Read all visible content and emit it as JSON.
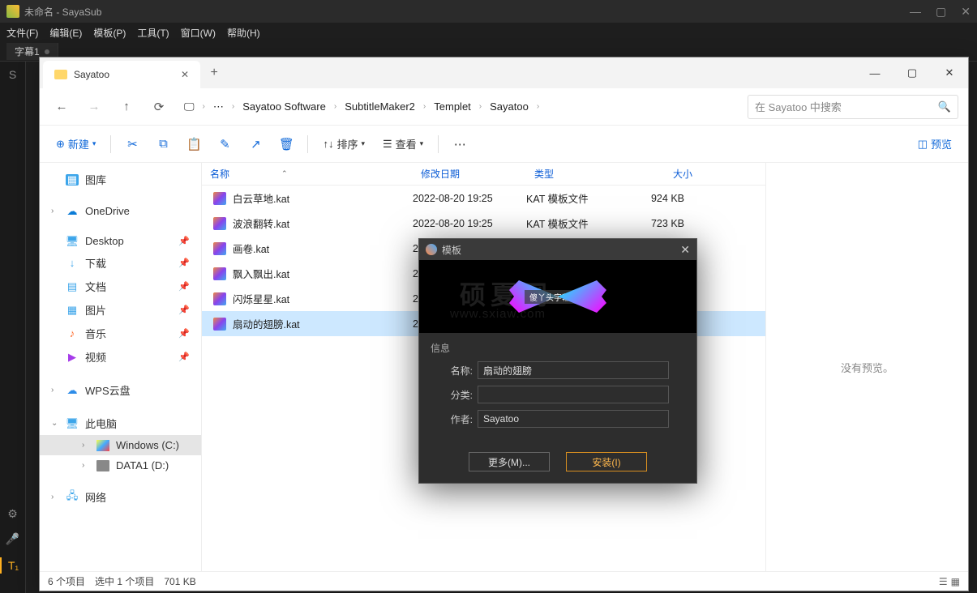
{
  "sayasub": {
    "title": "未命名 - SayaSub",
    "menus": [
      "文件(F)",
      "编辑(E)",
      "模板(P)",
      "工具(T)",
      "窗口(W)",
      "帮助(H)"
    ],
    "tab": "字幕1",
    "leftbar_items": [
      "S",
      "⚙",
      "🎤",
      "T₁"
    ]
  },
  "explorer": {
    "tab_title": "Sayatoo",
    "breadcrumb": [
      "Sayatoo Software",
      "SubtitleMaker2",
      "Templet",
      "Sayatoo"
    ],
    "search_placeholder": "在 Sayatoo 中搜索",
    "toolbar": {
      "new_label": "新建",
      "sort_label": "排序",
      "view_label": "查看",
      "preview_label": "预览"
    },
    "columns": {
      "name": "名称",
      "date": "修改日期",
      "type": "类型",
      "size": "大小"
    },
    "sidebar": [
      {
        "label": "图库",
        "icon": "gallery",
        "chev": ""
      },
      {
        "label": "OneDrive",
        "icon": "onedrive",
        "chev": "›"
      },
      {
        "label": "Desktop",
        "icon": "desktop",
        "chev": "",
        "pin": true
      },
      {
        "label": "下载",
        "icon": "download",
        "chev": "",
        "pin": true
      },
      {
        "label": "文档",
        "icon": "doc",
        "chev": "",
        "pin": true
      },
      {
        "label": "图片",
        "icon": "pic",
        "chev": "",
        "pin": true
      },
      {
        "label": "音乐",
        "icon": "music",
        "chev": "",
        "pin": true
      },
      {
        "label": "视频",
        "icon": "video",
        "chev": "",
        "pin": true
      },
      {
        "label": "WPS云盘",
        "icon": "wps",
        "chev": "›"
      },
      {
        "label": "此电脑",
        "icon": "pc",
        "chev": "⌄"
      },
      {
        "label": "Windows (C:)",
        "icon": "win",
        "chev": "›",
        "indent": 2,
        "selected": true
      },
      {
        "label": "DATA1 (D:)",
        "icon": "drive",
        "chev": "›",
        "indent": 2
      },
      {
        "label": "网络",
        "icon": "net",
        "chev": "›"
      }
    ],
    "files": [
      {
        "name": "白云草地.kat",
        "date": "2022-08-20 19:25",
        "type": "KAT 模板文件",
        "size": "924 KB"
      },
      {
        "name": "波浪翻转.kat",
        "date": "2022-08-20 19:25",
        "type": "KAT 模板文件",
        "size": "723 KB"
      },
      {
        "name": "画卷.kat",
        "date": "2022-",
        "type": "",
        "size": ""
      },
      {
        "name": "飘入飘出.kat",
        "date": "2022-",
        "type": "",
        "size": ""
      },
      {
        "name": "闪烁星星.kat",
        "date": "2022-",
        "type": "",
        "size": ""
      },
      {
        "name": "扇动的翅膀.kat",
        "date": "2022-",
        "type": "",
        "size": "",
        "selected": true
      }
    ],
    "preview_empty": "没有预览。",
    "status": {
      "count": "6 个项目",
      "selection": "选中 1 个项目",
      "size": "701 KB"
    }
  },
  "modal": {
    "title": "模板",
    "preview_caption": "傻丫头字幕精灵",
    "watermark1": "硕夏网",
    "watermark2": "www.sxiaw.com",
    "info_label": "信息",
    "fields": {
      "name_label": "名称:",
      "name_value": "扇动的翅膀",
      "category_label": "分类:",
      "category_value": "",
      "author_label": "作者:",
      "author_value": "Sayatoo"
    },
    "buttons": {
      "more": "更多(M)...",
      "install": "安装(I)"
    }
  }
}
